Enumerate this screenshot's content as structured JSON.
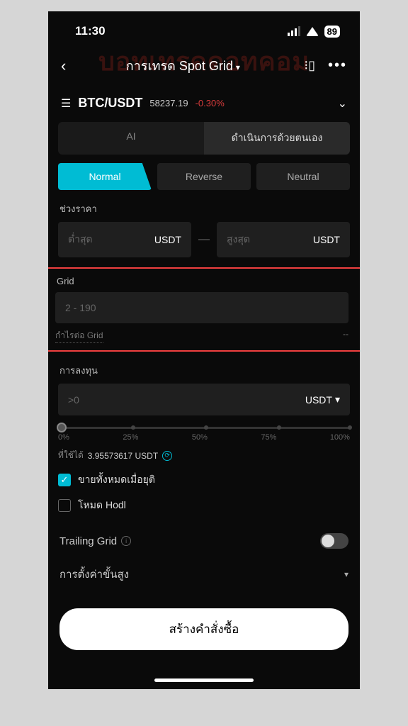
{
  "status": {
    "time": "11:30",
    "battery": "89"
  },
  "watermark": "บอทเทรดดอทคอม",
  "nav": {
    "title": "การเทรด Spot Grid"
  },
  "pair": {
    "symbol": "BTC/USDT",
    "price": "58237.19",
    "change": "-0.30%"
  },
  "tabs_mode": {
    "ai": "AI",
    "manual": "ดำเนินการด้วยตนเอง"
  },
  "tabs_type": {
    "normal": "Normal",
    "reverse": "Reverse",
    "neutral": "Neutral"
  },
  "price_range": {
    "label": "ช่วงราคา",
    "min_ph": "ต่ำสุด",
    "max_ph": "สูงสุด",
    "unit": "USDT"
  },
  "grid": {
    "label": "Grid",
    "placeholder": "2 - 190",
    "helper": "กำไรต่อ Grid",
    "helper_val": "--"
  },
  "invest": {
    "label": "การลงทุน",
    "placeholder": ">0",
    "unit": "USDT"
  },
  "slider": {
    "p0": "0%",
    "p25": "25%",
    "p50": "50%",
    "p75": "75%",
    "p100": "100%"
  },
  "available": {
    "label": "ที่ใช้ได้",
    "value": "3.95573617 USDT"
  },
  "checks": {
    "sell_all": "ขายทั้งหมดเมื่อยุติ",
    "hodl": "โหมด Hodl"
  },
  "trailing": {
    "label": "Trailing Grid"
  },
  "advanced": {
    "label": "การตั้งค่าขั้นสูง"
  },
  "cta": {
    "label": "สร้างคำสั่งซื้อ"
  }
}
